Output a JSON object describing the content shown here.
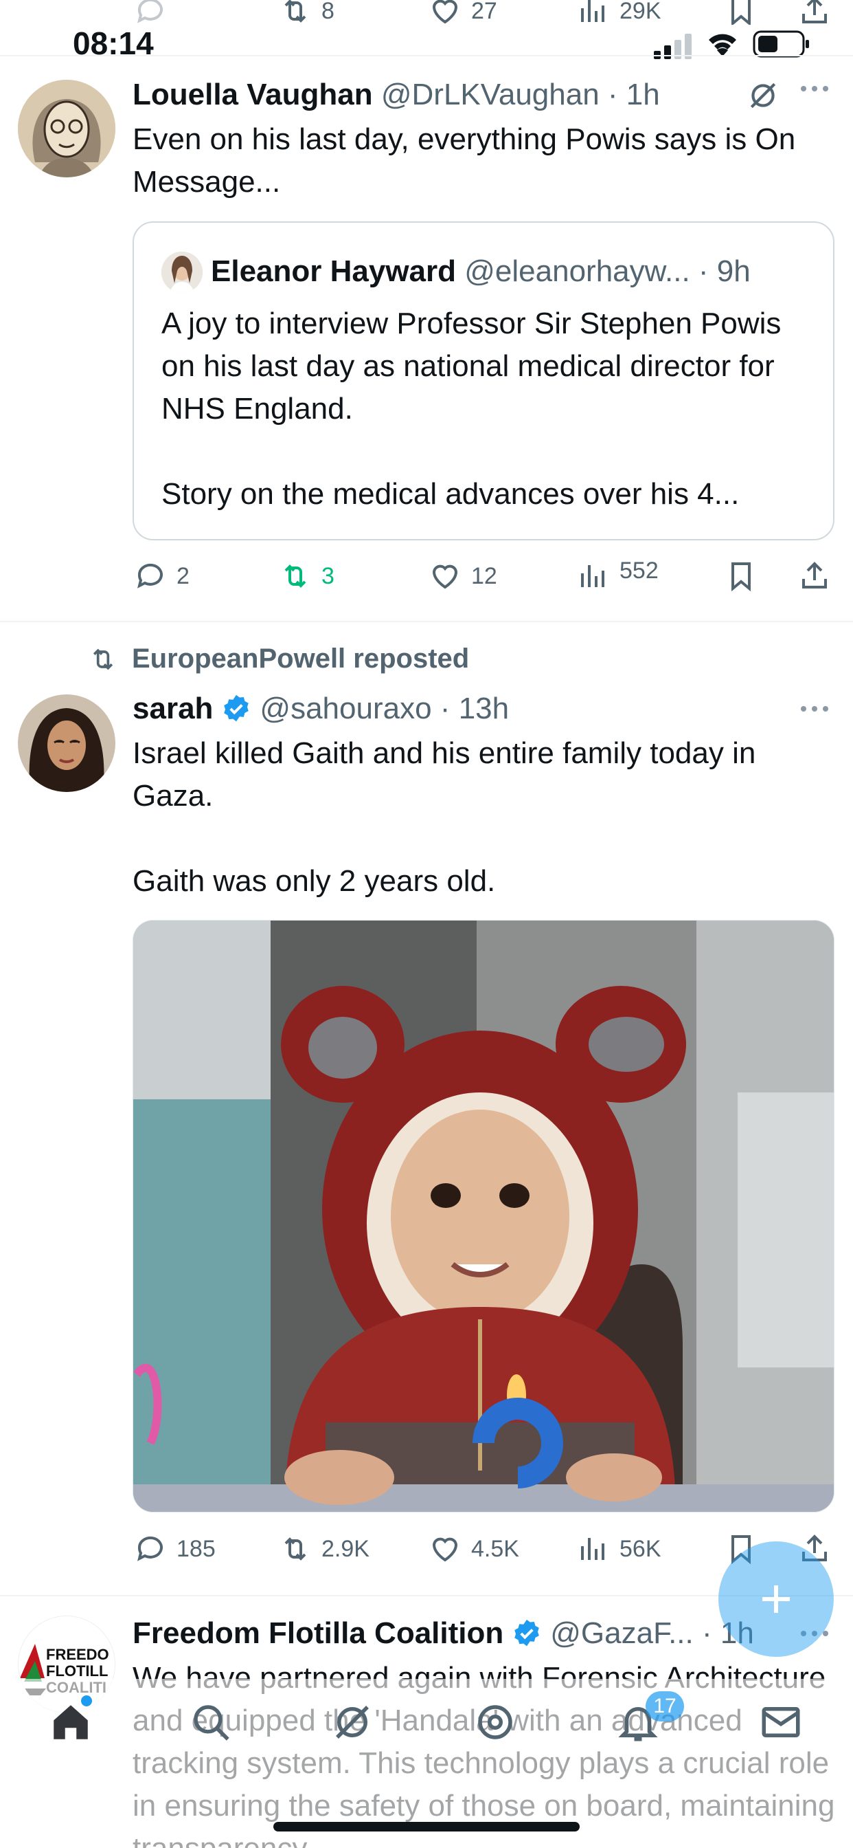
{
  "status_bar": {
    "time": "08:14"
  },
  "prev_tweet_stats": {
    "retweets": "8",
    "likes": "27",
    "views": "29K"
  },
  "tweet1": {
    "author_name": "Louella Vaughan",
    "author_handle": "@DrLKVaughan",
    "time": "1h",
    "text": "Even on his last day, everything Powis says is On Message...",
    "quote": {
      "author_name": "Eleanor Hayward",
      "author_handle": "@eleanorhayw...",
      "time": "9h",
      "text": "A joy to interview Professor Sir Stephen Powis on his last day as national medical director for NHS England.\n\nStory on the medical advances over his 4..."
    },
    "stats": {
      "replies": "2",
      "retweets": "3",
      "likes": "12",
      "views": "552"
    }
  },
  "tweet2": {
    "repost_label": "EuropeanPowell reposted",
    "author_name": "sarah",
    "author_handle": "@sahouraxo",
    "time": "13h",
    "text": "Israel killed Gaith and his entire family today in Gaza.\n\nGaith was only 2 years old.",
    "stats": {
      "replies": "185",
      "retweets": "2.9K",
      "likes": "4.5K",
      "views": "56K"
    }
  },
  "tweet3": {
    "author_name": "Freedom Flotilla Coalition",
    "author_handle": "@GazaF...",
    "time": "1h",
    "avatar_text": "FREEDO FLOTILL COALITI",
    "text": "We have partnered again with Forensic Architecture and equipped the 'Handala' with an advanced tracking system. This technology plays a crucial role in ensuring the safety of those on board, maintaining transparency"
  },
  "nav": {
    "notifications_badge": "17"
  },
  "colors": {
    "accent": "#1d9bf0",
    "retweet_green": "#00ba7c",
    "muted": "#536471"
  }
}
